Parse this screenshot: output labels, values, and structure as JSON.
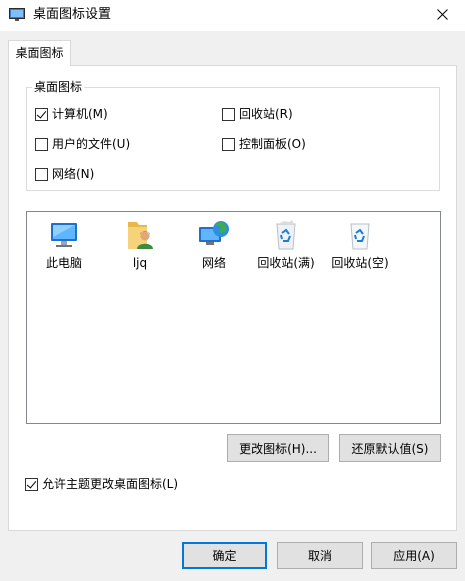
{
  "window": {
    "title": "桌面图标设置"
  },
  "tabs": [
    {
      "label": "桌面图标"
    }
  ],
  "group": {
    "label": "桌面图标",
    "checkboxes": [
      {
        "label": "计算机(M)",
        "checked": true
      },
      {
        "label": "回收站(R)",
        "checked": false
      },
      {
        "label": "用户的文件(U)",
        "checked": false
      },
      {
        "label": "控制面板(O)",
        "checked": false
      },
      {
        "label": "网络(N)",
        "checked": false
      }
    ]
  },
  "icons": [
    {
      "label": "此电脑",
      "icon": "computer-icon"
    },
    {
      "label": "ljq",
      "icon": "user-folder-icon"
    },
    {
      "label": "网络",
      "icon": "network-icon"
    },
    {
      "label": "回收站(满)",
      "icon": "recycle-bin-full-icon"
    },
    {
      "label": "回收站(空)",
      "icon": "recycle-bin-empty-icon"
    }
  ],
  "buttons": {
    "change_icon": "更改图标(H)...",
    "restore_default": "还原默认值(S)",
    "ok": "确定",
    "cancel": "取消",
    "apply": "应用(A)"
  },
  "theme_option": {
    "label": "允许主题更改桌面图标(L)",
    "checked": true
  },
  "colors": {
    "accent": "#0078d7",
    "window_bg": "#f0f0f0",
    "panel_bg": "#ffffff"
  }
}
